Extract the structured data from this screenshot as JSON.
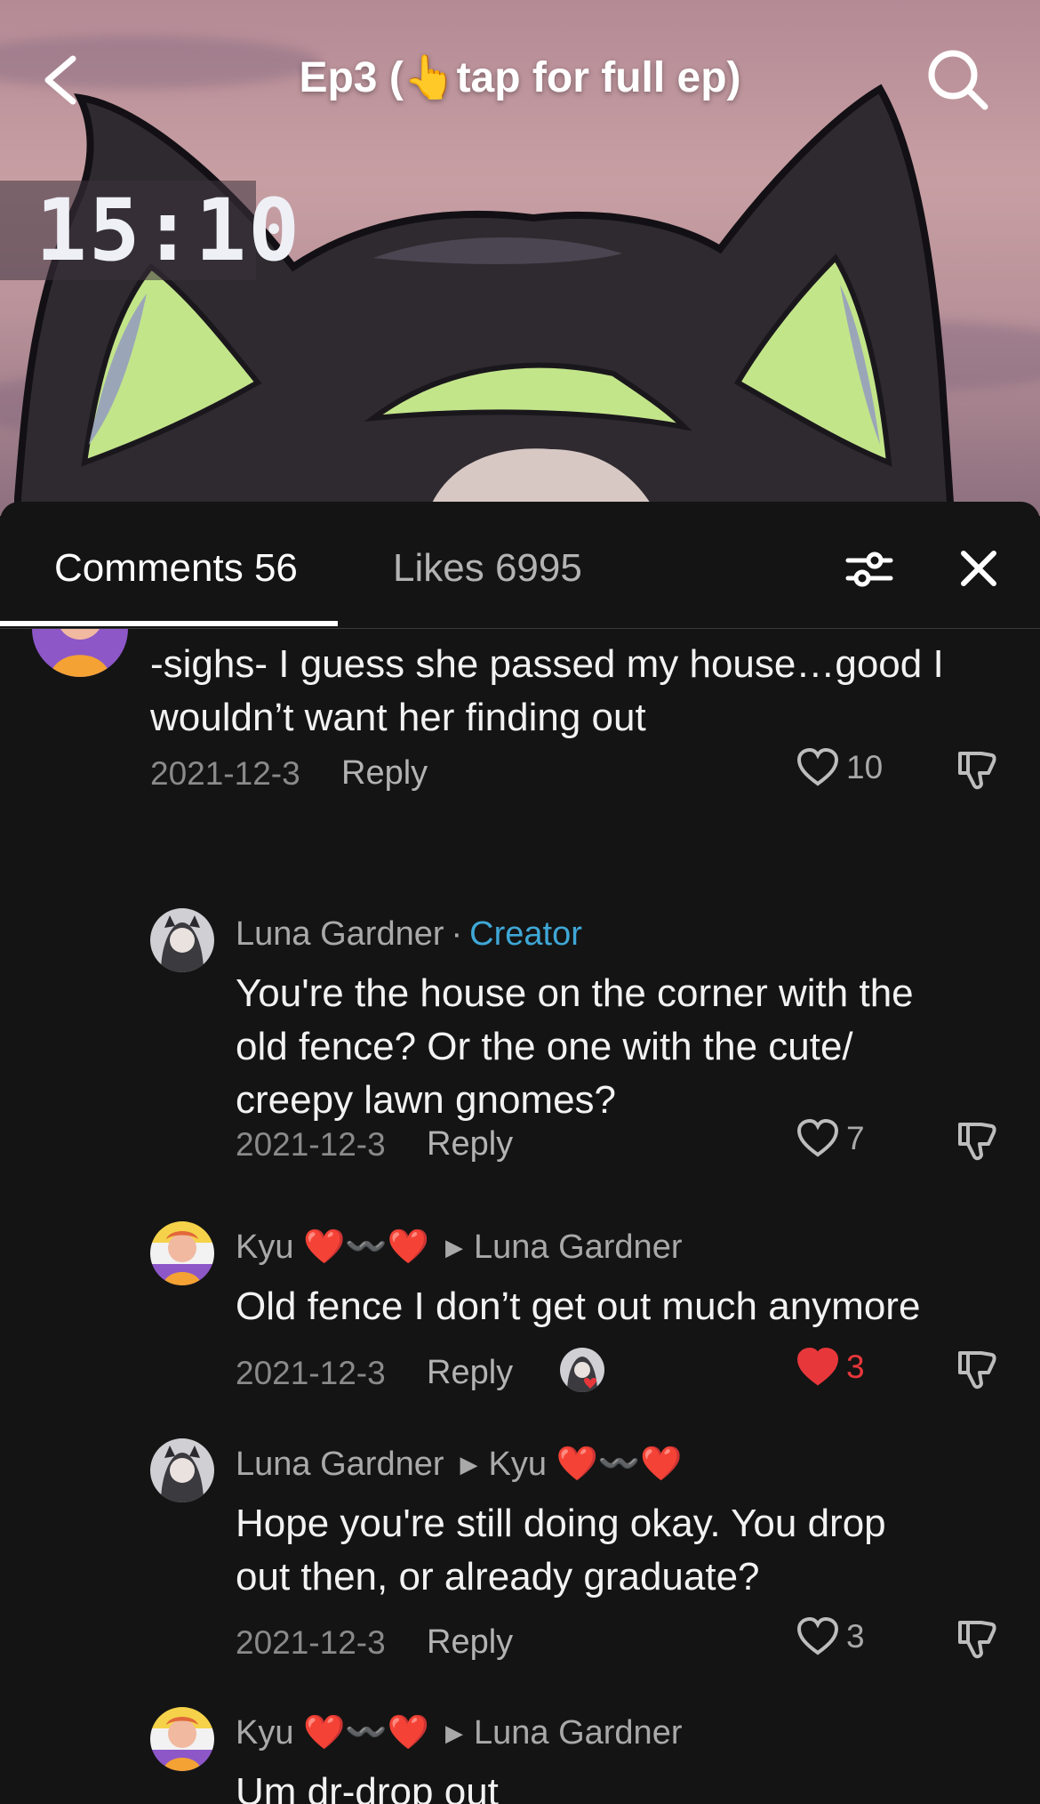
{
  "header": {
    "title": "Ep3 (👆tap for full ep)",
    "timer": "15:10"
  },
  "tabs": {
    "comments_label": "Comments 56",
    "likes_label": "Likes 6995"
  },
  "comments": [
    {
      "text_line1": "-sighs- I guess she passed my house…good I",
      "text_line2": "wouldn’t want her finding out",
      "date": "2021-12-3",
      "reply": "Reply",
      "likes": "10"
    },
    {
      "author": "Luna Gardner",
      "separator": "·",
      "badge": "Creator",
      "text_line1": "You're the house on the corner with the",
      "text_line2": "old fence? Or the one with the cute/",
      "text_line3": "creepy lawn gnomes?",
      "date": "2021-12-3",
      "reply": "Reply",
      "likes": "7"
    },
    {
      "author": "Kyu ❤️〰️❤️",
      "reply_to": "Luna Gardner",
      "text_line1": "Old fence I don’t get out much anymore",
      "date": "2021-12-3",
      "reply": "Reply",
      "likes": "3",
      "liked": true
    },
    {
      "author": "Luna Gardner",
      "reply_to": "Kyu ❤️〰️❤️",
      "text_line1": "Hope you're still doing okay. You drop",
      "text_line2": "out then, or already graduate?",
      "date": "2021-12-3",
      "reply": "Reply",
      "likes": "3"
    },
    {
      "author": "Kyu ❤️〰️❤️",
      "reply_to": "Luna Gardner",
      "text_line1": "Um dr-drop out"
    }
  ],
  "colors": {
    "sheet_bg": "#141414",
    "creator": "#3fa7d6",
    "liked_heart": "#e8373b"
  },
  "icons": [
    "back-chevron-icon",
    "search-icon",
    "filter-sliders-icon",
    "close-icon",
    "heart-icon",
    "dislike-icon"
  ]
}
